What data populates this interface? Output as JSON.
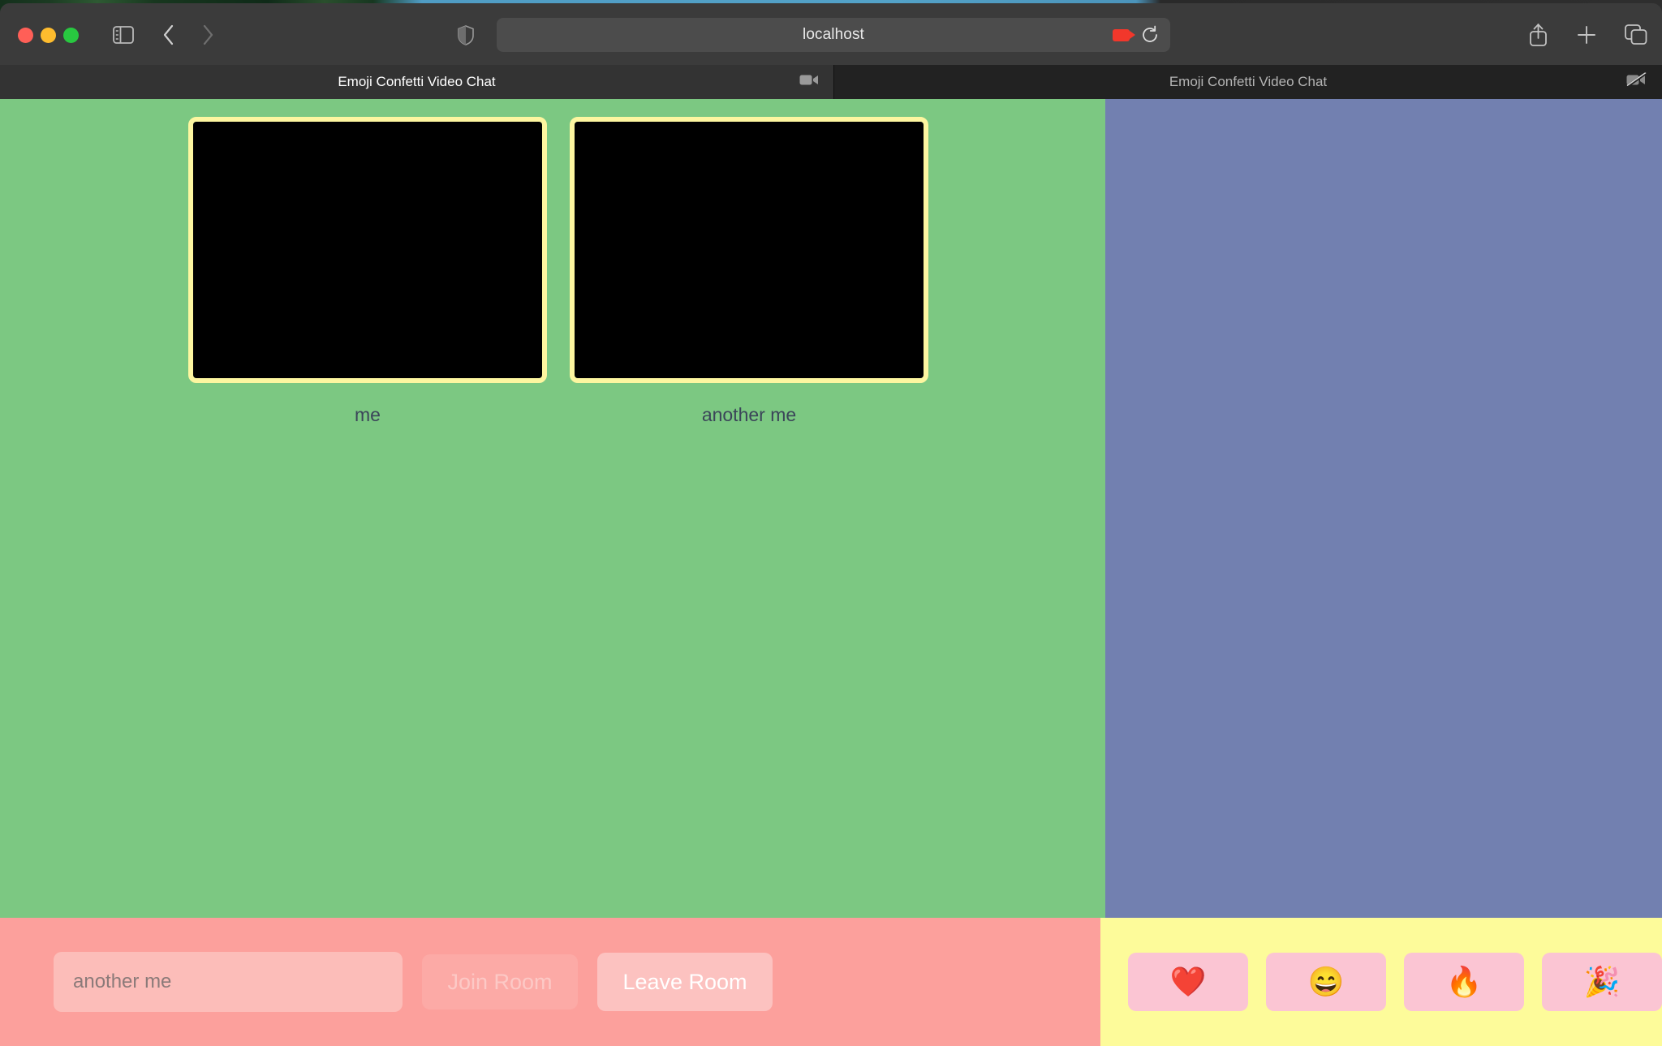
{
  "window": {
    "traffic_lights": [
      "close",
      "minimize",
      "zoom"
    ],
    "toolbar": {
      "sidebar_label": "Show Sidebar",
      "back_label": "Back",
      "forward_label": "Forward",
      "shield_label": "Privacy Report",
      "url": "localhost",
      "camera_active_label": "Camera in use",
      "reload_label": "Reload",
      "share_label": "Share",
      "new_tab_label": "New Tab",
      "tab_overview_label": "Tab Overview"
    },
    "tabs": [
      {
        "title": "Emoji Confetti Video Chat",
        "active": true,
        "media_icon": "camera-icon"
      },
      {
        "title": "Emoji Confetti Video Chat",
        "active": false,
        "media_icon": "camera-muted-icon"
      }
    ]
  },
  "app": {
    "video_tiles": [
      {
        "label": "me"
      },
      {
        "label": "another me"
      }
    ],
    "controls": {
      "name_value": "another me",
      "name_placeholder": "another me",
      "join_label": "Join Room",
      "leave_label": "Leave Room"
    },
    "emoji_buttons": [
      {
        "name": "heart",
        "glyph": "❤️"
      },
      {
        "name": "grin",
        "glyph": "😄"
      },
      {
        "name": "fire",
        "glyph": "🔥"
      },
      {
        "name": "party-popper",
        "glyph": "🎉"
      }
    ]
  },
  "colors": {
    "video_area": "#7cc882",
    "side_panel": "#7280b0",
    "controls_bar": "#fca09c",
    "emoji_bar": "#fdfb9a",
    "tile_border": "#fdf6a0",
    "label_text": "#3b4559"
  }
}
